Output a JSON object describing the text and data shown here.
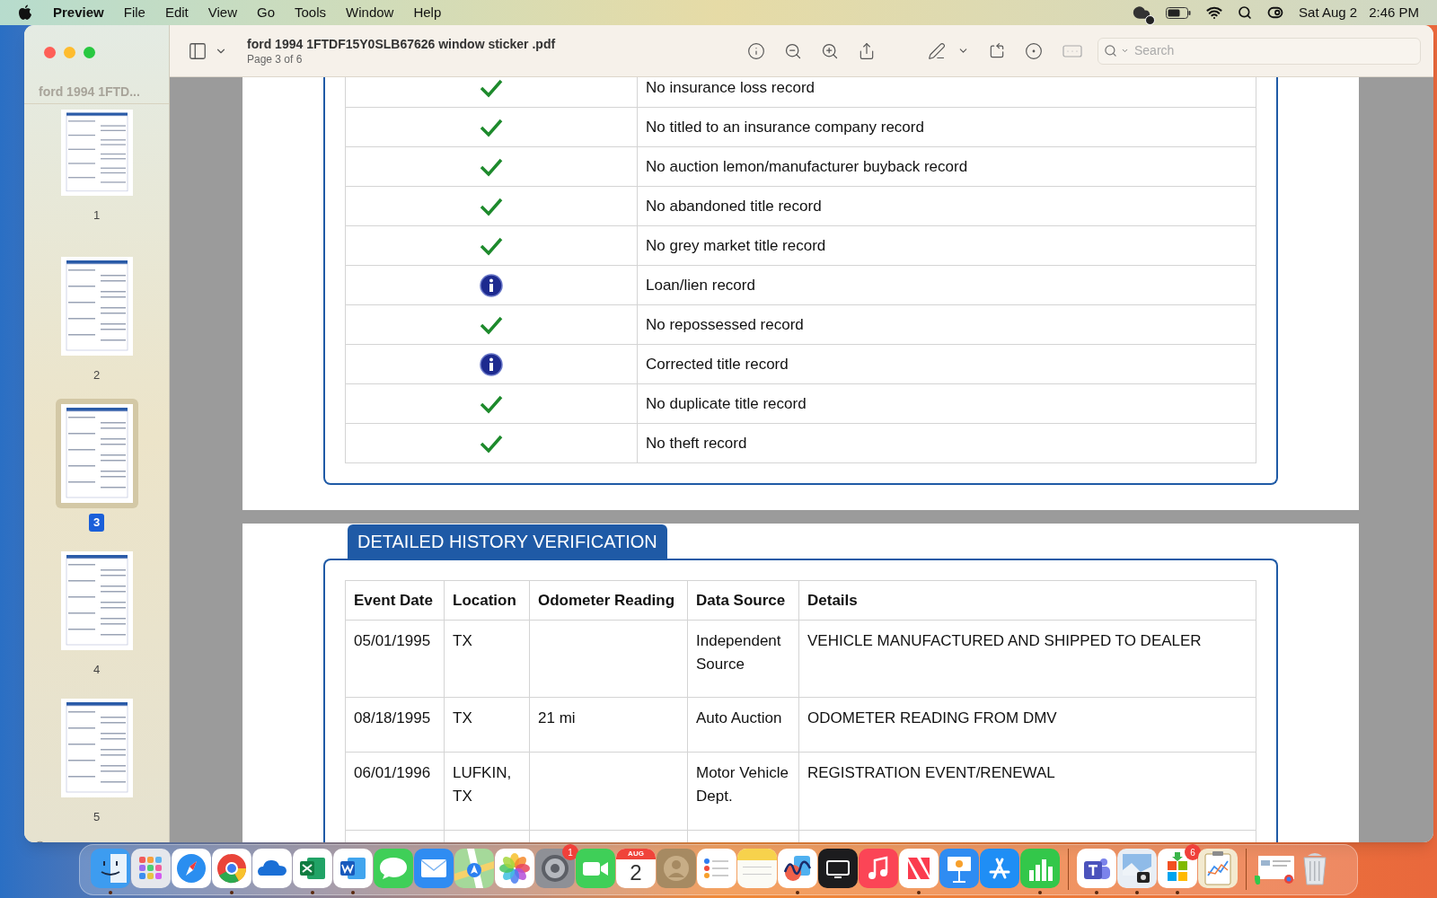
{
  "menu_bar": {
    "app": "Preview",
    "menus": [
      "File",
      "Edit",
      "View",
      "Go",
      "Tools",
      "Window",
      "Help"
    ],
    "date": "Sat Aug 2",
    "time": "2:46 PM"
  },
  "window": {
    "title": "ford 1994 1FTDF15Y0SLB67626 window sticker .pdf",
    "subtitle": "Page 3 of 6",
    "search": {
      "placeholder": "Search"
    }
  },
  "sidebar": {
    "title": "ford 1994 1FTD...",
    "pages": [
      {
        "label": "1",
        "selected": false
      },
      {
        "label": "2",
        "selected": false
      },
      {
        "label": "3",
        "selected": true
      },
      {
        "label": "4",
        "selected": false
      },
      {
        "label": "5",
        "selected": false
      }
    ]
  },
  "record_checks": [
    {
      "kind": "check",
      "text": "No insurance loss record"
    },
    {
      "kind": "check",
      "text": "No titled to an insurance company record"
    },
    {
      "kind": "check",
      "text": "No auction lemon/manufacturer buyback record"
    },
    {
      "kind": "check",
      "text": "No abandoned title record"
    },
    {
      "kind": "check",
      "text": "No grey market title record"
    },
    {
      "kind": "info",
      "text": "Loan/lien record"
    },
    {
      "kind": "check",
      "text": "No repossessed record"
    },
    {
      "kind": "info",
      "text": "Corrected title record"
    },
    {
      "kind": "check",
      "text": "No duplicate title record"
    },
    {
      "kind": "check",
      "text": "No theft record"
    }
  ],
  "history": {
    "heading": "DETAILED HISTORY VERIFICATION",
    "columns": [
      "Event Date",
      "Location",
      "Odometer Reading",
      "Data Source",
      "Details"
    ],
    "rows": [
      {
        "event_date": "05/01/1995",
        "location": "TX",
        "odometer": "",
        "data_source": "Independent Source",
        "details": "VEHICLE MANUFACTURED AND SHIPPED TO DEALER"
      },
      {
        "event_date": "08/18/1995",
        "location": "TX",
        "odometer": "21 mi",
        "data_source": "Auto Auction",
        "details": "ODOMETER READING FROM DMV"
      },
      {
        "event_date": "06/01/1996",
        "location": "LUFKIN, TX",
        "odometer": "",
        "data_source": "Motor Vehicle Dept.",
        "details": "REGISTRATION EVENT/RENEWAL"
      }
    ]
  },
  "dock": {
    "apps": [
      {
        "kind": "finder",
        "running": true
      },
      {
        "kind": "launchpad",
        "running": false
      },
      {
        "kind": "safari",
        "running": false
      },
      {
        "kind": "chrome",
        "running": true
      },
      {
        "kind": "onedrive",
        "running": false
      },
      {
        "kind": "excel",
        "running": true
      },
      {
        "kind": "word",
        "running": true
      },
      {
        "kind": "messages",
        "running": false
      },
      {
        "kind": "mail",
        "running": false
      },
      {
        "kind": "maps",
        "running": false
      },
      {
        "kind": "photos",
        "running": false
      },
      {
        "kind": "settings",
        "running": false,
        "badge": "1"
      },
      {
        "kind": "facetime",
        "running": false
      },
      {
        "kind": "calendar",
        "running": false,
        "month": "AUG",
        "day": "2"
      },
      {
        "kind": "contacts",
        "running": false
      },
      {
        "kind": "reminders",
        "running": false
      },
      {
        "kind": "notes",
        "running": false
      },
      {
        "kind": "freeform",
        "running": true
      },
      {
        "kind": "tv",
        "running": false
      },
      {
        "kind": "music",
        "running": false
      },
      {
        "kind": "news",
        "running": true
      },
      {
        "kind": "keynote",
        "running": false
      },
      {
        "kind": "appstore",
        "running": false
      },
      {
        "kind": "numbers",
        "running": true
      },
      {
        "kind": "separator"
      },
      {
        "kind": "teams",
        "running": true
      },
      {
        "kind": "preview",
        "running": true
      },
      {
        "kind": "store",
        "running": true,
        "badge": "6"
      },
      {
        "kind": "clipboard",
        "running": false
      },
      {
        "kind": "separator"
      },
      {
        "kind": "window",
        "running": false
      },
      {
        "kind": "trash",
        "running": false
      }
    ]
  }
}
